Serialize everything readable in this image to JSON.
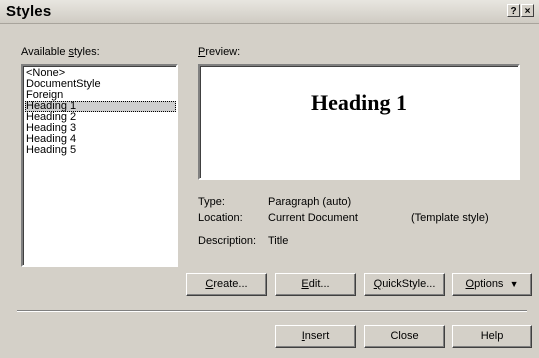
{
  "window": {
    "title": "Styles",
    "help_glyph": "?",
    "close_glyph": "×"
  },
  "styles": {
    "label_pre": "Available ",
    "label_ul": "s",
    "label_post": "tyles:",
    "items": [
      "<None>",
      "DocumentStyle",
      "Foreign",
      "Heading 1",
      "Heading 2",
      "Heading 3",
      "Heading 4",
      "Heading 5"
    ],
    "selected_index": 3
  },
  "preview": {
    "label_ul": "P",
    "label_post": "review:",
    "sample_text": "Heading 1"
  },
  "details": {
    "type_label": "Type:",
    "type_value": "Paragraph (auto)",
    "location_label": "Location:",
    "location_value": "Current Document",
    "template_note": "(Template style)",
    "description_label": "Description:",
    "description_value": "Title"
  },
  "buttons": {
    "create_ul": "C",
    "create_post": "reate...",
    "edit_ul": "E",
    "edit_post": "dit...",
    "quickstyle_ul": "Q",
    "quickstyle_post": "uickStyle...",
    "options_ul": "O",
    "options_post": "ptions",
    "options_arrow": "▼",
    "insert_ul": "I",
    "insert_post": "nsert",
    "close_label": "Close",
    "help_label": "Help"
  }
}
